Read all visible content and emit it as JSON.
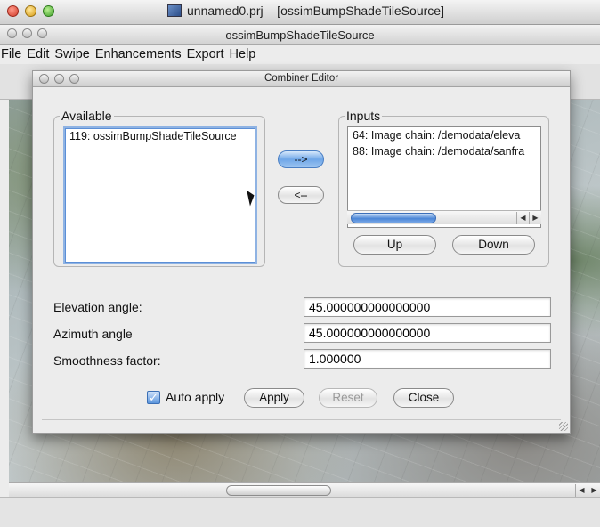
{
  "top_window": {
    "title": "unnamed0.prj – [ossimBumpShadeTileSource]",
    "icon": "document-icon"
  },
  "main_window": {
    "title": "ossimBumpShadeTileSource"
  },
  "menubar": {
    "items": [
      "File",
      "Edit",
      "Swipe",
      "Enhancements",
      "Export",
      "Help"
    ]
  },
  "dialog": {
    "title": "Combiner Editor",
    "available": {
      "label": "Available",
      "items": [
        "119: ossimBumpShadeTileSource"
      ]
    },
    "inputs": {
      "label": "Inputs",
      "items": [
        "64: Image chain: /demodata/eleva",
        "88: Image chain: /demodata/sanfra"
      ]
    },
    "buttons": {
      "add": "-->",
      "remove": "<--",
      "up": "Up",
      "down": "Down",
      "apply": "Apply",
      "reset": "Reset",
      "close": "Close"
    },
    "params": {
      "elevation_label": "Elevation angle:",
      "elevation_value": "45.000000000000000",
      "azimuth_label": "Azimuth angle",
      "azimuth_value": "45.000000000000000",
      "smoothness_label": "Smoothness factor:",
      "smoothness_value": "1.000000"
    },
    "auto_apply": {
      "label": "Auto apply",
      "checked": true
    }
  },
  "colors": {
    "selection_blue": "#5c8fd6",
    "aqua_blue": "#4b86d7",
    "close_red": "#d23b2a",
    "minimize_yellow": "#d89c14",
    "zoom_green": "#3d9d28"
  }
}
